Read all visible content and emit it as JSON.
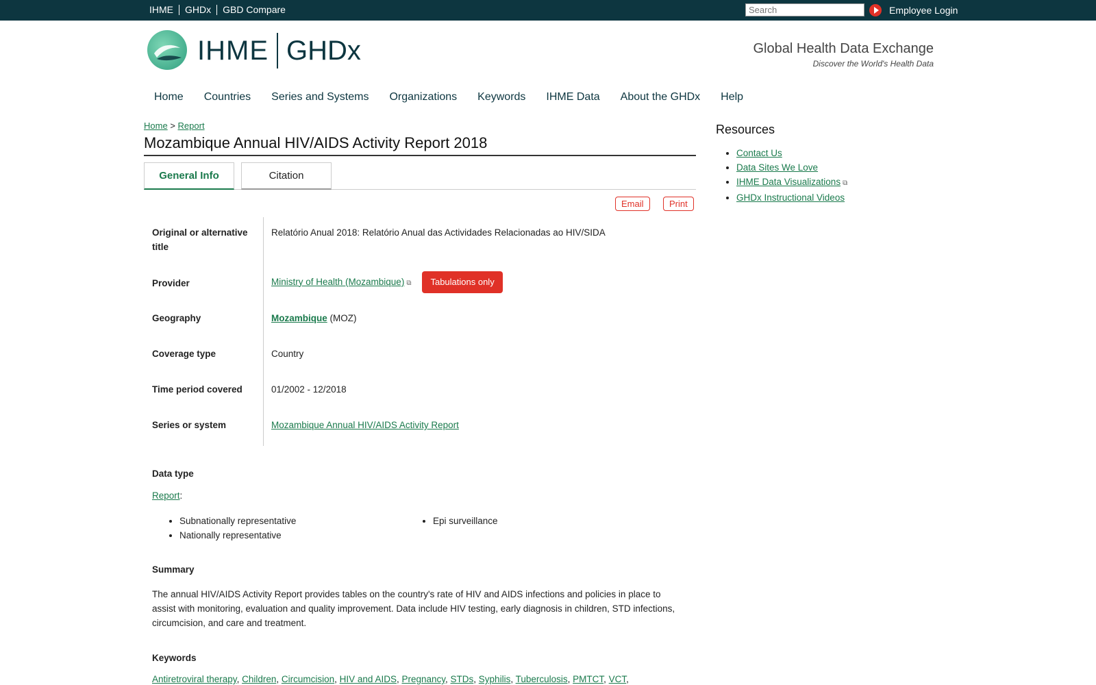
{
  "topbar": {
    "links": [
      "IHME",
      "GHDx",
      "GBD Compare"
    ],
    "search_placeholder": "Search",
    "login": "Employee Login"
  },
  "header": {
    "logo_ihme": "IHME",
    "logo_ghdx": "GHDx",
    "tagline": "Global Health Data Exchange",
    "subtagline": "Discover the World's Health Data"
  },
  "nav": [
    "Home",
    "Countries",
    "Series and Systems",
    "Organizations",
    "Keywords",
    "IHME Data",
    "About the GHDx",
    "Help"
  ],
  "breadcrumb": {
    "home": "Home",
    "sep": ">",
    "report": "Report"
  },
  "title": "Mozambique Annual HIV/AIDS Activity Report 2018",
  "tabs": {
    "general": "General Info",
    "citation": "Citation"
  },
  "actions": {
    "email": "Email",
    "print": "Print"
  },
  "info": {
    "alt_title_label": "Original or alternative title",
    "alt_title_value": "Relatório Anual 2018: Relatório Anual das Actividades Relacionadas ao HIV/SIDA",
    "provider_label": "Provider",
    "provider_value": "Ministry of Health (Mozambique)",
    "provider_badge": "Tabulations only",
    "geo_label": "Geography",
    "geo_value": "Mozambique",
    "geo_code": "(MOZ)",
    "coverage_label": "Coverage type",
    "coverage_value": "Country",
    "period_label": "Time period covered",
    "period_value": "01/2002 - 12/2018",
    "series_label": "Series or system",
    "series_value": "Mozambique Annual HIV/AIDS Activity Report"
  },
  "data_type": {
    "label": "Data type",
    "link": "Report",
    "colon": ":",
    "col1": [
      "Subnationally representative",
      "Nationally representative"
    ],
    "col2": [
      "Epi surveillance"
    ]
  },
  "summary": {
    "label": "Summary",
    "text": "The annual HIV/AIDS Activity Report provides tables on the country's rate of HIV and AIDS infections and policies in place to assist with monitoring, evaluation and quality improvement. Data include HIV testing, early diagnosis in children, STD infections, circumcision, and care and treatment."
  },
  "keywords": {
    "label": "Keywords",
    "items": [
      "Antiretroviral therapy",
      "Children",
      "Circumcision",
      "HIV and AIDS",
      "Pregnancy",
      "STDs",
      "Syphilis",
      "Tuberculosis",
      "PMTCT",
      "VCT"
    ]
  },
  "sidebar": {
    "title": "Resources",
    "items": [
      "Contact Us",
      "Data Sites We Love",
      "IHME Data Visualizations",
      "GHDx Instructional Videos"
    ]
  }
}
